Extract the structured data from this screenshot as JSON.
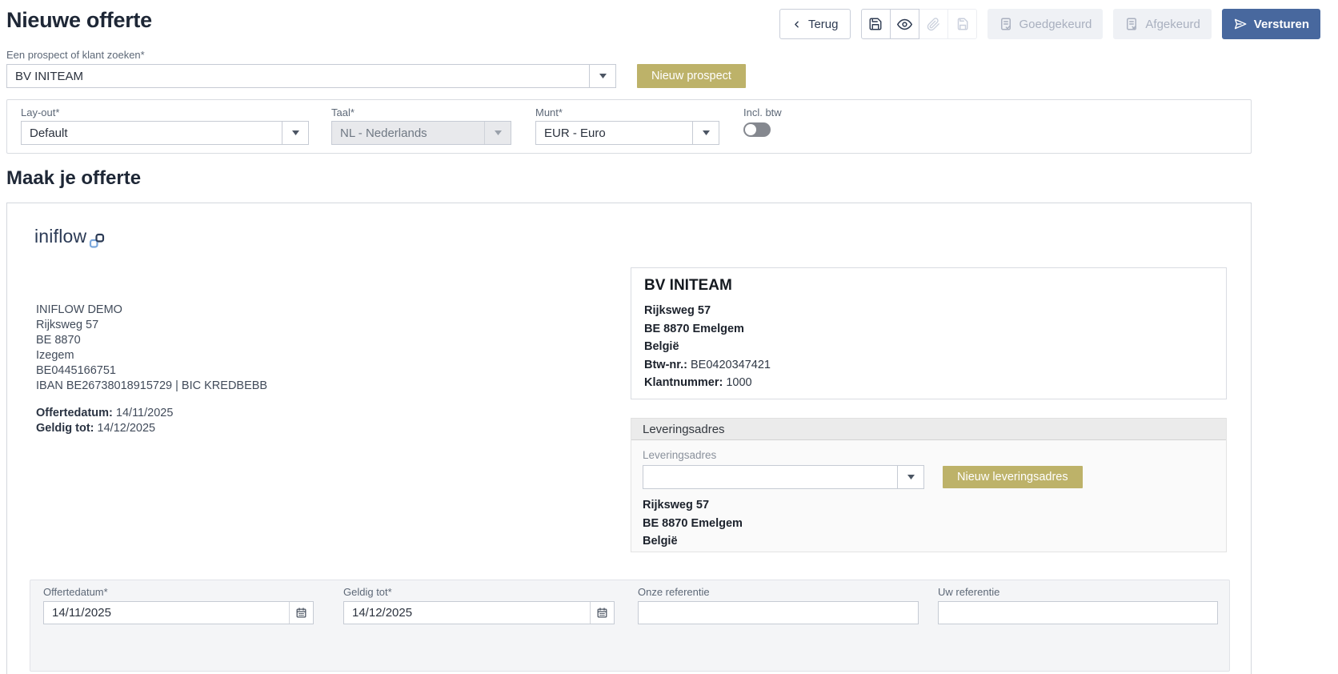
{
  "page": {
    "title": "Nieuwe offerte",
    "section_title": "Maak je offerte"
  },
  "header": {
    "back_label": "Terug",
    "approve_label": "Goedgekeurd",
    "reject_label": "Afgekeurd",
    "send_label": "Versturen"
  },
  "prospect": {
    "label": "Een prospect of klant zoeken*",
    "value": "BV INITEAM",
    "new_button": "Nieuw prospect"
  },
  "settings": {
    "layout_label": "Lay-out*",
    "layout_value": "Default",
    "language_label": "Taal*",
    "language_value": "NL - Nederlands",
    "currency_label": "Munt*",
    "currency_value": "EUR - Euro",
    "vat_toggle_label": "Incl. btw",
    "vat_toggle_state": "off"
  },
  "document": {
    "logo_text": "iniflow",
    "company": {
      "name": "INIFLOW DEMO",
      "street": "Rijksweg 57",
      "postal": "BE 8870",
      "city": "Izegem",
      "vat": "BE0445166751",
      "bank": "IBAN BE26738018915729 | BIC KREDBEBB"
    },
    "dates": {
      "offer_label": "Offertedatum:",
      "offer_value": "14/11/2025",
      "valid_label": "Geldig tot:",
      "valid_value": "14/12/2025"
    },
    "customer": {
      "name": "BV INITEAM",
      "street": "Rijksweg 57",
      "city": "BE 8870 Emelgem",
      "country": "België",
      "vat_label": "Btw-nr.:",
      "vat_value": "BE0420347421",
      "number_label": "Klantnummer:",
      "number_value": "1000"
    },
    "delivery": {
      "panel_title": "Leveringsadres",
      "select_label": "Leveringsadres",
      "select_value": "",
      "new_button": "Nieuw leveringsadres",
      "street": "Rijksweg 57",
      "city": "BE 8870 Emelgem",
      "country": "België"
    },
    "form": {
      "offer_date_label": "Offertedatum*",
      "offer_date_value": "14/11/2025",
      "valid_label": "Geldig tot*",
      "valid_value": "14/12/2025",
      "our_ref_label": "Onze referentie",
      "our_ref_value": "",
      "your_ref_label": "Uw referentie",
      "your_ref_value": ""
    }
  },
  "colors": {
    "primary_blue": "#48689e",
    "gold": "#bdb269",
    "heading": "#1e2736",
    "disabled_bg": "#eff1f5",
    "disabled_text": "#a9b0bf",
    "panel_border": "#d9dce1"
  }
}
